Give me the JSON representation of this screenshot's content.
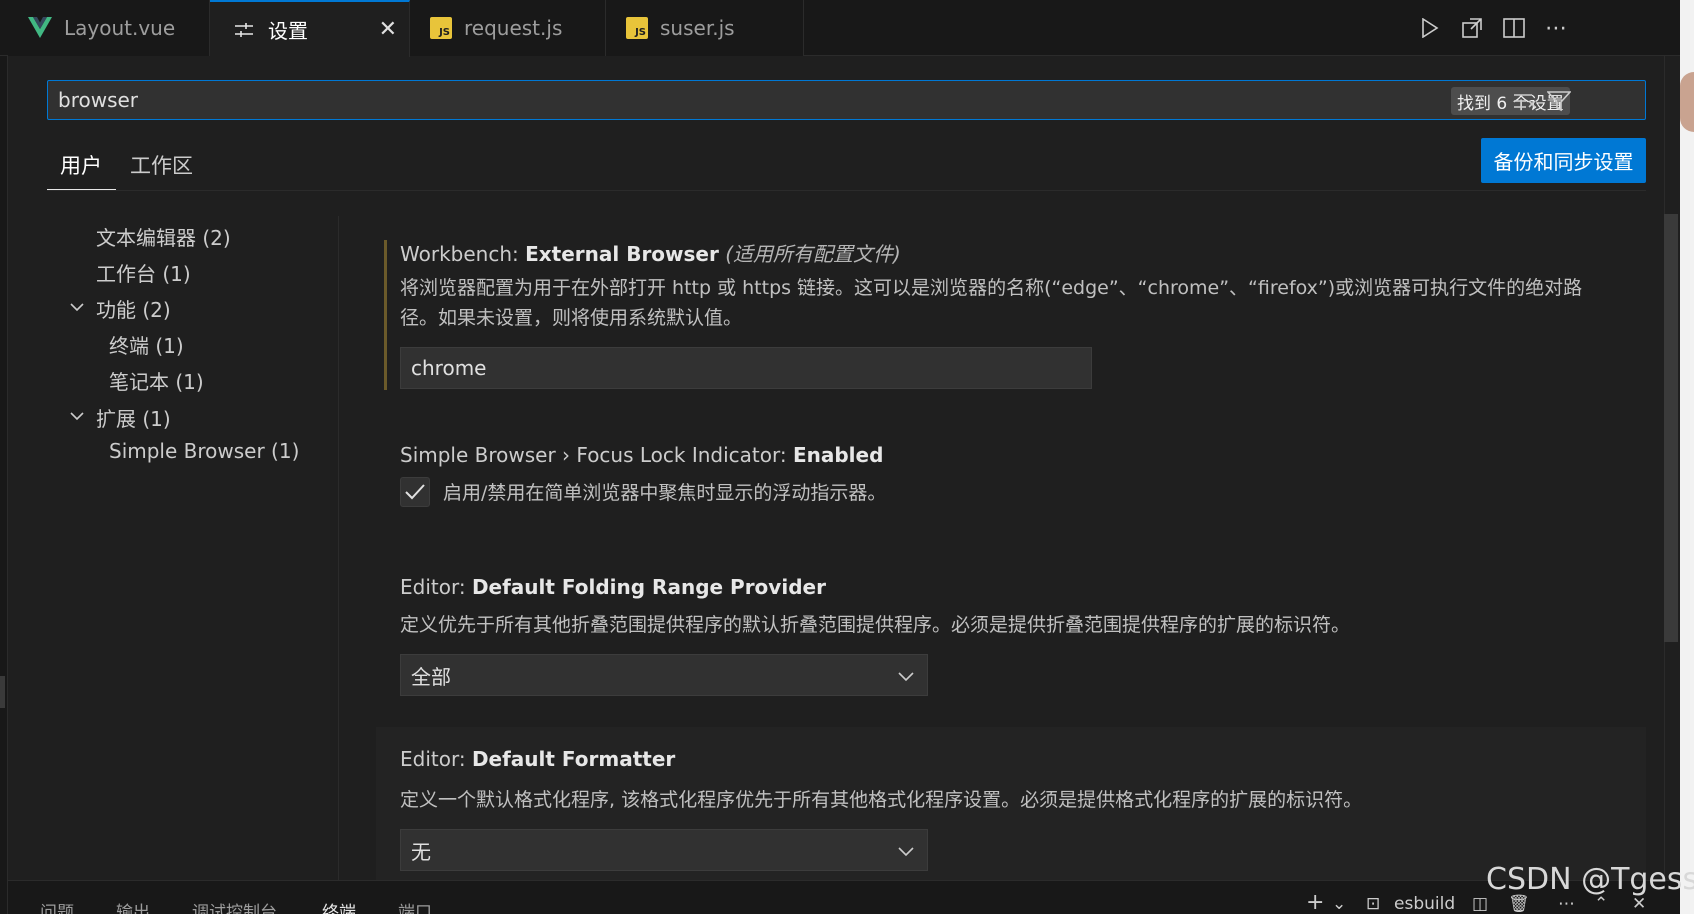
{
  "tabs": [
    {
      "label": "Layout.vue",
      "icon": "vue-icon"
    },
    {
      "label": "设置",
      "icon": "settings-sliders-icon",
      "active": true
    },
    {
      "label": "request.js",
      "icon": "js-file-icon"
    },
    {
      "label": "suser.js",
      "icon": "js-file-icon"
    }
  ],
  "search": {
    "value": "browser",
    "result_count": "找到 6 个设置"
  },
  "scopes": {
    "user": "用户",
    "workspace": "工作区"
  },
  "sync_button": "备份和同步设置",
  "toc": [
    {
      "label": "文本编辑器 (2)"
    },
    {
      "label": "工作台 (1)"
    },
    {
      "label": "功能 (2)"
    },
    {
      "label": "终端 (1)"
    },
    {
      "label": "笔记本 (1)"
    },
    {
      "label": "扩展 (1)"
    },
    {
      "label": "Simple Browser (1)"
    }
  ],
  "settings": {
    "external_browser": {
      "category": "Workbench: ",
      "name": "External Browser",
      "scope_note": "(适用所有配置文件)",
      "description": "将浏览器配置为用于在外部打开 http 或 https 链接。这可以是浏览器的名称(“edge”、“chrome”、“firefox”)或浏览器可执行文件的绝对路径。如果未设置，则将使用系统默认值。",
      "value": "chrome"
    },
    "focus_lock": {
      "category": "Simple Browser › Focus Lock Indicator: ",
      "name": "Enabled",
      "checkbox_label": "启用/禁用在简单浏览器中聚焦时显示的浮动指示器。",
      "checked": true
    },
    "folding": {
      "category": "Editor: ",
      "name": "Default Folding Range Provider",
      "description": "定义优先于所有其他折叠范围提供程序的默认折叠范围提供程序。必须是提供折叠范围提供程序的扩展的标识符。",
      "value": "全部"
    },
    "formatter": {
      "category": "Editor: ",
      "name": "Default Formatter",
      "description": "定义一个默认格式化程序, 该格式化程序优先于所有其他格式化程序设置。必须是提供格式化程序的扩展的标识符。",
      "value": "无"
    }
  },
  "panel": {
    "tabs": [
      "问题",
      "输出",
      "调试控制台",
      "终端",
      "端口"
    ],
    "terminal_name": "esbuild"
  },
  "watermark": "CSDN @Tgess",
  "colors": {
    "accent": "#0078d4",
    "background": "#1f1f1f"
  }
}
